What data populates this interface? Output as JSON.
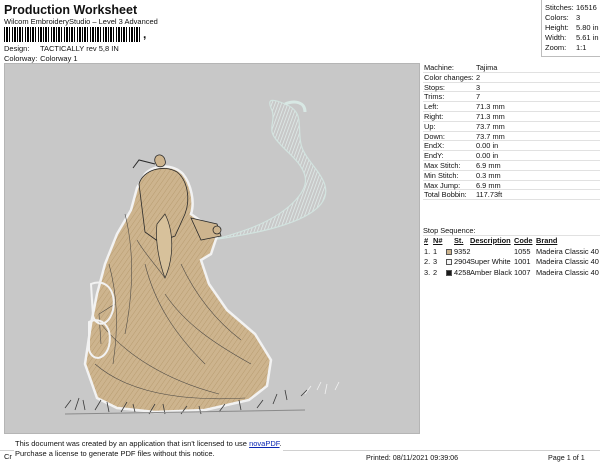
{
  "header": {
    "title": "Production Worksheet",
    "subtitle": "Wilcom EmbroideryStudio – Level 3 Advanced",
    "barcode_char": ",",
    "design_label": "Design:",
    "design_value": "TACTICALLY  rev 5,8 IN",
    "colorway_label": "Colorway:",
    "colorway_value": "Colorway 1"
  },
  "stats": [
    {
      "label": "Stitches:",
      "value": "16516"
    },
    {
      "label": "Colors:",
      "value": "3"
    },
    {
      "label": "Height:",
      "value": "5.80 in"
    },
    {
      "label": "Width:",
      "value": "5.61 in"
    },
    {
      "label": "Zoom:",
      "value": "1:1"
    }
  ],
  "info": [
    {
      "label": "Machine:",
      "value": "Tajima"
    },
    {
      "label": "Color changes:",
      "value": "2"
    },
    {
      "label": "Stops:",
      "value": "3"
    },
    {
      "label": "Trims:",
      "value": "7"
    },
    {
      "label": "Left:",
      "value": "71.3 mm"
    },
    {
      "label": "Right:",
      "value": "71.3 mm"
    },
    {
      "label": "Up:",
      "value": "73.7 mm"
    },
    {
      "label": "Down:",
      "value": "73.7 mm"
    },
    {
      "label": "EndX:",
      "value": "0.00 in"
    },
    {
      "label": "EndY:",
      "value": "0.00 in"
    },
    {
      "label": "Max Stitch:",
      "value": "6.9 mm"
    },
    {
      "label": "Min Stitch:",
      "value": "0.3 mm"
    },
    {
      "label": "Max Jump:",
      "value": "6.9 mm"
    },
    {
      "label": "Total Bobbin:",
      "value": "117.73ft"
    }
  ],
  "stop_sequence": {
    "title": "Stop Sequence:",
    "headers": {
      "n": "#",
      "nn": "N#",
      "st": "St.",
      "desc": "Description",
      "code": "Code",
      "brand": "Brand"
    },
    "rows": [
      {
        "n": "1.",
        "nn": "1",
        "color": "#cdb48e",
        "st": "9352",
        "desc": "",
        "code": "1055",
        "brand": "Madeira Classic 40"
      },
      {
        "n": "2.",
        "nn": "3",
        "color": "#f4f4f4",
        "st": "2904",
        "desc": "Super White",
        "code": "1001",
        "brand": "Madeira Classic 40"
      },
      {
        "n": "3.",
        "nn": "2",
        "color": "#1a1a1a",
        "st": "4258",
        "desc": "Amber Black",
        "code": "1007",
        "brand": "Madeira Classic 40"
      }
    ]
  },
  "notice": {
    "cr": "Cr",
    "line1_prefix": "This document was created by an application that isn't licensed to use ",
    "link": "novaPDF",
    "line1_suffix": ".",
    "line2": "Purchase a license to generate PDF files without this notice."
  },
  "footer": {
    "printed": "Printed: 08/11/2021 09:39:06",
    "page": "Page 1 of 1"
  },
  "colors": {
    "background": "#c8c8c8",
    "tan": "#cdb48e",
    "white_thread": "#f4f4f4",
    "black_thread": "#1a1a1a",
    "smoke": "#d9ece8"
  }
}
